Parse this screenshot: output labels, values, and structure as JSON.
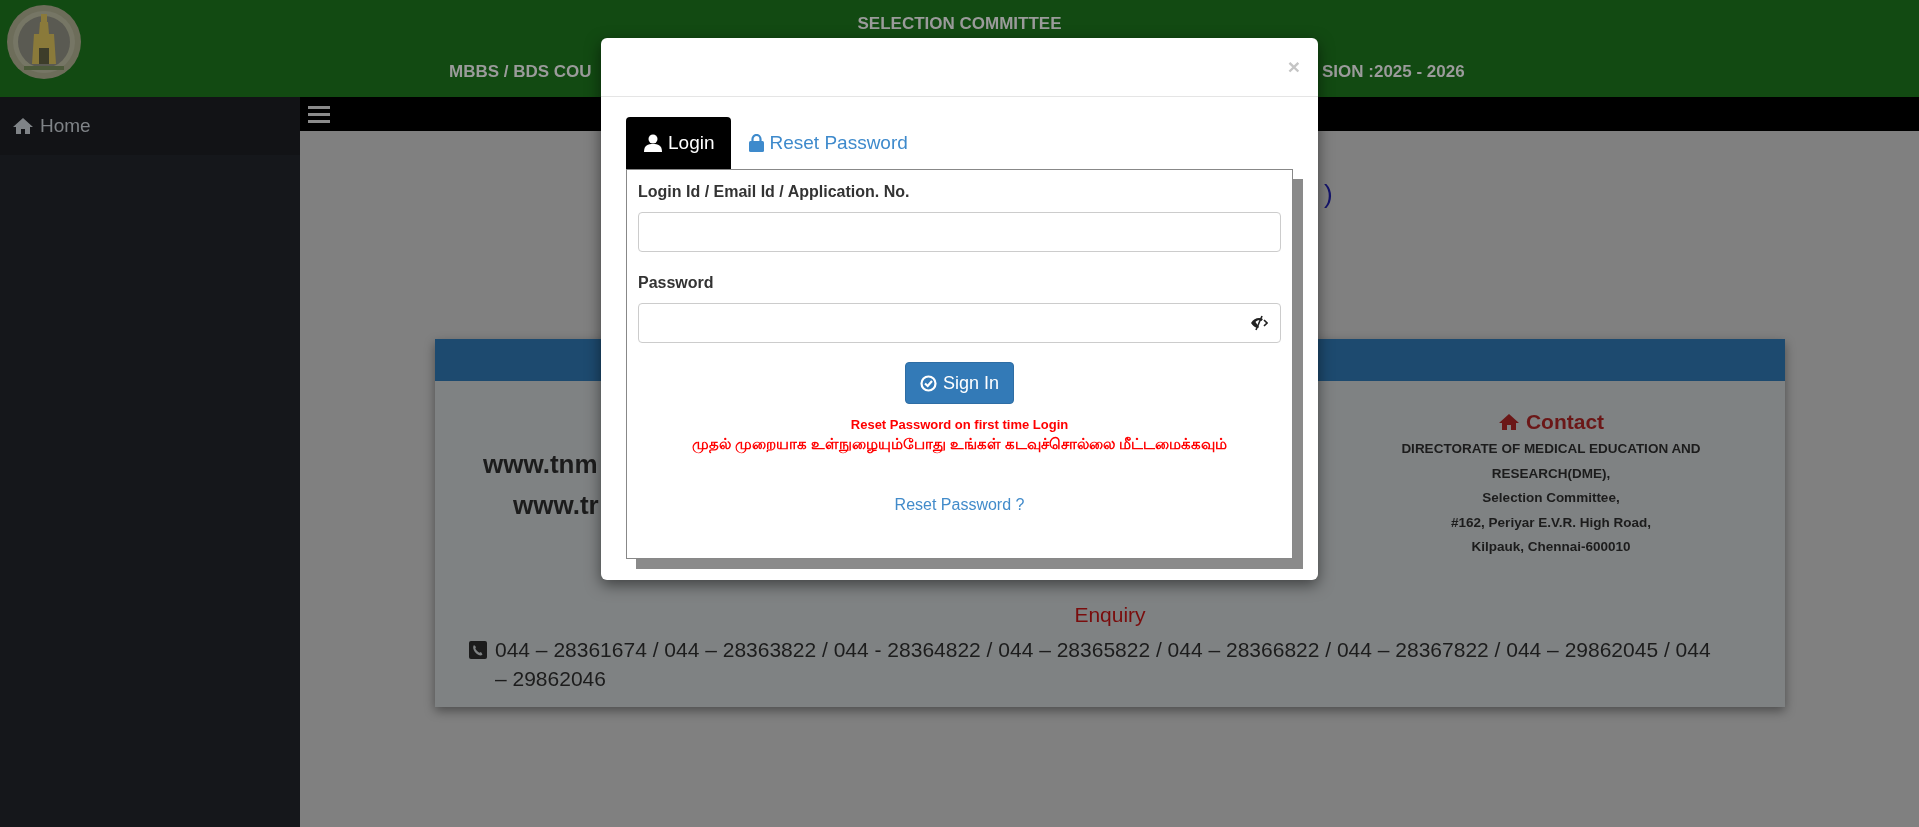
{
  "header": {
    "title": "SELECTION COMMITTEE",
    "subtitle_left": "MBBS / BDS COU",
    "subtitle_right": "SION :2025 - 2026"
  },
  "sidebar": {
    "items": [
      {
        "label": "Home"
      }
    ]
  },
  "page": {
    "heading_fragment": ")",
    "websites": [
      "www.tnm",
      "www.tr"
    ],
    "contact": {
      "title": "Contact",
      "lines": [
        "DIRECTORATE OF MEDICAL EDUCATION AND",
        "RESEARCH(DME),",
        "Selection Committee,",
        "#162, Periyar E.V.R. High Road,",
        "Kilpauk, Chennai-600010"
      ]
    },
    "enquiry": {
      "title": "Enquiry",
      "phones": "044 – 28361674 / 044 – 28363822 / 044 - 28364822 / 044 – 28365822 / 044 – 28366822 / 044 – 28367822 / 044 – 29862045 / 044 – 29862046"
    }
  },
  "modal": {
    "close": "×",
    "tabs": [
      {
        "label": "Login",
        "selected": true
      },
      {
        "label": "Reset Password",
        "selected": false
      }
    ],
    "fields": [
      {
        "label": "Login Id / Email Id / Application. No.",
        "kind": "text"
      },
      {
        "label": "Password",
        "kind": "password"
      }
    ],
    "button": "Sign In",
    "notice": [
      "Reset Password on first time Login",
      "முதல் முறையாக உள்நுழையும்போது உங்கள் கடவுச்சொல்லை மீட்டமைக்கவும்"
    ],
    "link": "Reset Password ?"
  }
}
